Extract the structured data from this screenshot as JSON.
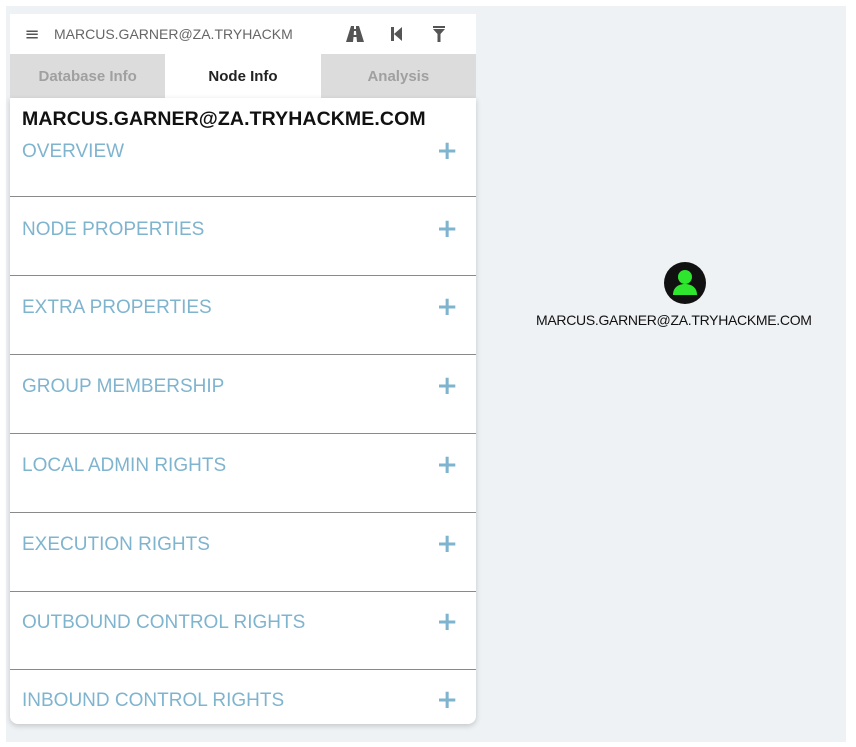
{
  "search": {
    "value": "MARCUS.GARNER@ZA.TRYHACKM"
  },
  "icons": {
    "menu": "hamburger-menu-icon",
    "pathfinding": "road-icon",
    "back": "step-backward-icon",
    "filter": "filter-icon",
    "node": "user-icon"
  },
  "tabs": [
    {
      "label": "Database Info",
      "active": false
    },
    {
      "label": "Node Info",
      "active": true
    },
    {
      "label": "Analysis",
      "active": false
    }
  ],
  "node_info": {
    "title": "MARCUS.GARNER@ZA.TRYHACKME.COM",
    "sections": [
      {
        "label": "OVERVIEW"
      },
      {
        "label": "NODE PROPERTIES"
      },
      {
        "label": "EXTRA PROPERTIES"
      },
      {
        "label": "GROUP MEMBERSHIP"
      },
      {
        "label": "LOCAL ADMIN RIGHTS"
      },
      {
        "label": "EXECUTION RIGHTS"
      },
      {
        "label": "OUTBOUND CONTROL RIGHTS"
      },
      {
        "label": "INBOUND CONTROL RIGHTS"
      }
    ],
    "expand_symbol": "+"
  },
  "graph": {
    "node_label": "MARCUS.GARNER@ZA.TRYHACKME.COM",
    "node_color": "#2ee62e"
  },
  "colors": {
    "section_text": "#7fb4cf",
    "canvas_bg": "#eef2f5",
    "tab_inactive_bg": "#dcdcdc"
  }
}
